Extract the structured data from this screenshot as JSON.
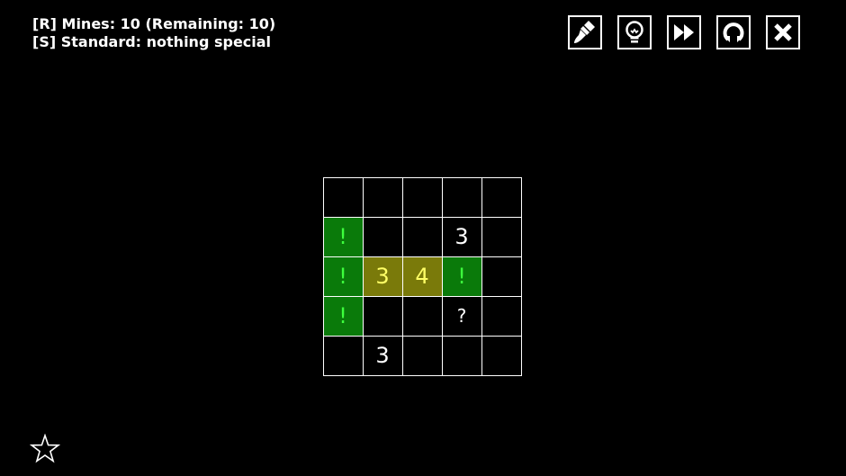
{
  "info": {
    "line1": "[R] Mines: 10 (Remaining: 10)",
    "line2": "[S] Standard: nothing special"
  },
  "toolbar": {
    "buttons": [
      {
        "icon": "brush-icon"
      },
      {
        "icon": "lightbulb-icon"
      },
      {
        "icon": "fast-forward-icon"
      },
      {
        "icon": "restart-icon"
      },
      {
        "icon": "close-icon"
      }
    ]
  },
  "board": {
    "rows": 5,
    "cols": 5,
    "cells": [
      [
        "",
        "",
        "",
        "",
        ""
      ],
      [
        "!",
        "",
        "",
        "3",
        ""
      ],
      [
        "!",
        "3",
        "4",
        "!",
        ""
      ],
      [
        "!",
        "",
        "",
        "?",
        ""
      ],
      [
        "",
        "3",
        "",
        "",
        ""
      ]
    ],
    "states": [
      [
        "hidden",
        "hidden",
        "hidden",
        "hidden",
        "hidden"
      ],
      [
        "flag",
        "hidden",
        "hidden",
        "number",
        "hidden"
      ],
      [
        "flag",
        "hint",
        "hint",
        "flag",
        "hidden"
      ],
      [
        "flag",
        "hidden",
        "hidden",
        "question",
        "hidden"
      ],
      [
        "hidden",
        "number",
        "hidden",
        "hidden",
        "hidden"
      ]
    ]
  },
  "colors": {
    "flag_bg": "#0a7a0a",
    "flag_text": "#3dff3d",
    "hint_bg": "#7a7a0a",
    "hint_text": "#ffff66"
  },
  "footer": {
    "icon": "star-icon"
  }
}
